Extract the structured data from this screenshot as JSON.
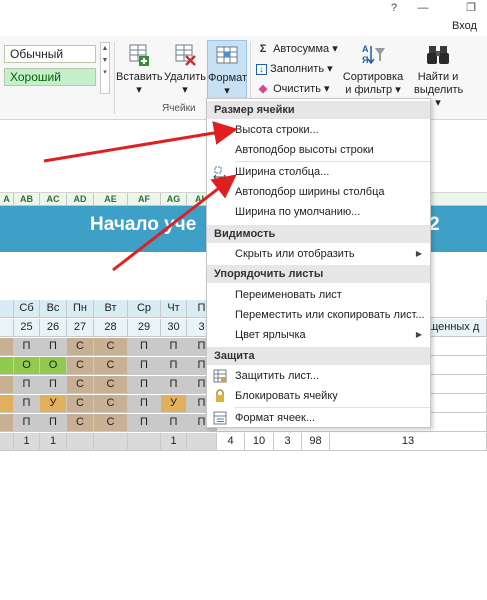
{
  "titlebar": {
    "help": "?",
    "minimize": "—",
    "restore": "❐",
    "signin": "Вход"
  },
  "ribbon": {
    "styles": {
      "normal": "Обычный",
      "good": "Хороший"
    },
    "cells": {
      "insert": "Вставить",
      "delete": "Удалить",
      "format": "Формат",
      "group_label": "Ячейки"
    },
    "editing": {
      "autosum": "Автосумма",
      "fill": "Заполнить",
      "clear": "Очистить",
      "sort_line1": "Сортировка",
      "sort_line2": "и фильтр",
      "find_line1": "Найти и",
      "find_line2": "выделить"
    }
  },
  "column_headers": [
    "A",
    "AB",
    "AC",
    "AD",
    "AE",
    "AF",
    "AG",
    "AH"
  ],
  "banner": {
    "title": "Начало уче",
    "number": "2"
  },
  "grid": {
    "days": [
      "Сб",
      "Вс",
      "Пн",
      "Вт",
      "Ср",
      "Чт",
      "П"
    ],
    "dates": [
      "25",
      "26",
      "27",
      "28",
      "29",
      "30",
      "3"
    ],
    "extra_header": "ущенных д",
    "rows": [
      [
        "П",
        "П",
        "С",
        "С",
        "П",
        "П",
        "П"
      ],
      [
        "О",
        "О",
        "С",
        "С",
        "П",
        "П",
        "П"
      ],
      [
        "П",
        "П",
        "С",
        "С",
        "П",
        "П",
        "П"
      ],
      [
        "П",
        "У",
        "С",
        "С",
        "П",
        "У",
        "П"
      ],
      [
        "П",
        "П",
        "С",
        "С",
        "П",
        "П",
        "П"
      ]
    ],
    "totals": [
      "1",
      "1",
      "",
      "",
      "",
      "1",
      ""
    ],
    "summary": [
      "4",
      "10",
      "3",
      "98",
      "13"
    ]
  },
  "menu": {
    "sections": {
      "cell_size": "Размер ячейки",
      "visibility": "Видимость",
      "arrange": "Упорядочить листы",
      "protection": "Защита"
    },
    "items": {
      "row_height": "Высота строки...",
      "autofit_row": "Автоподбор высоты строки",
      "col_width": "Ширина столбца...",
      "autofit_col": "Автоподбор ширины столбца",
      "default_width": "Ширина по умолчанию...",
      "hide_show": "Скрыть или отобразить",
      "rename": "Переименовать лист",
      "move_copy": "Переместить или скопировать лист...",
      "tab_color": "Цвет ярлычка",
      "protect_sheet": "Защитить лист...",
      "lock_cell": "Блокировать ячейку",
      "format_cells": "Формат ячеек..."
    }
  },
  "colors": {
    "banner": "#3ea0c7",
    "arrow": "#e02020",
    "format_active": "#c7e0f4"
  }
}
